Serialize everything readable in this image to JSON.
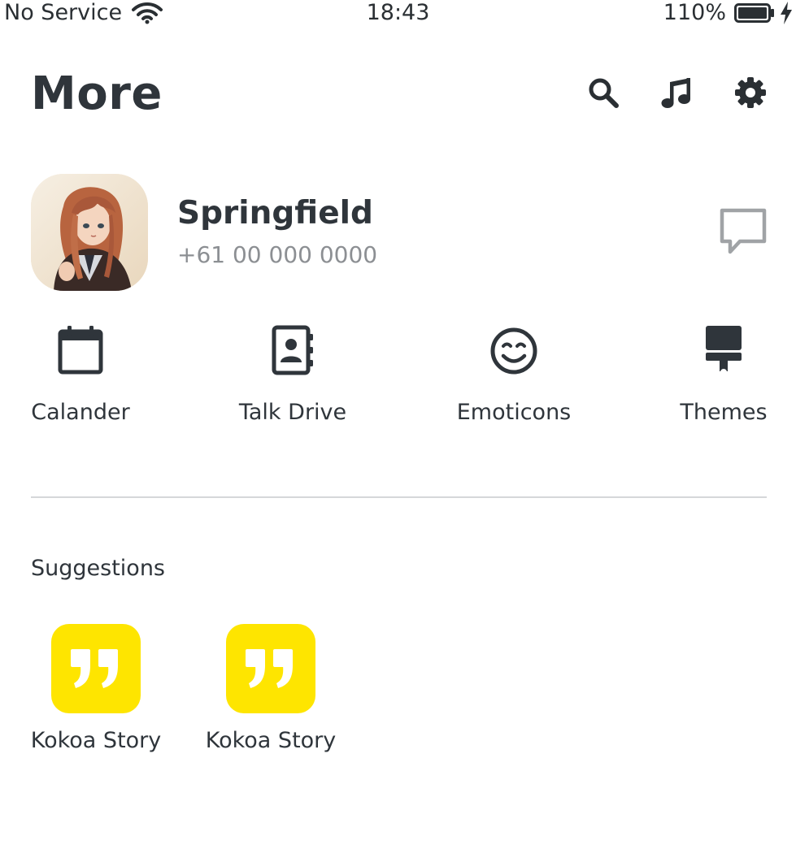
{
  "status_bar": {
    "carrier": "No Service",
    "time": "18:43",
    "battery": "110%"
  },
  "header": {
    "title": "More",
    "icons": [
      "search-icon",
      "music-note-icon",
      "gear-icon"
    ]
  },
  "profile": {
    "name": "Springfield",
    "phone": "+61 00 000 0000"
  },
  "quick_actions": [
    {
      "label": "Calander",
      "icon": "calendar-icon"
    },
    {
      "label": "Talk Drive",
      "icon": "contacts-book-icon"
    },
    {
      "label": "Emoticons",
      "icon": "smiley-icon"
    },
    {
      "label": "Themes",
      "icon": "paint-brush-icon"
    }
  ],
  "suggestions": {
    "title": "Suggestions",
    "items": [
      {
        "label": "Kokoa Story",
        "icon": "quote-icon"
      },
      {
        "label": "Kokoa Story",
        "icon": "quote-icon"
      }
    ]
  },
  "colors": {
    "text": "#2f353b",
    "muted": "#8c8f93",
    "accent_yellow": "#fee500",
    "divider": "#d5d7d9"
  }
}
